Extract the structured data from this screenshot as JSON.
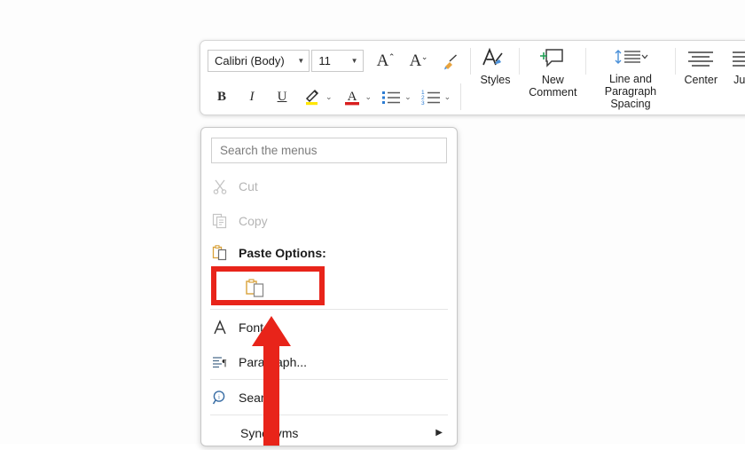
{
  "app": {
    "context": "word-mini-toolbar-and-context-menu"
  },
  "colors": {
    "annotation_red": "#e8241a",
    "highlight_yellow": "#ffe600",
    "font_color_red": "#d81f1f",
    "accent_blue": "#2b7cd3",
    "paste_gold": "#d9a23a",
    "disabled_gray": "#b5b5b5"
  },
  "toolbar": {
    "font_name": "Calibri (Body)",
    "font_size": "11",
    "font_name_caret": "▼",
    "font_size_caret": "▼",
    "increase_font_label": "A",
    "increase_font_marker": "⌃",
    "decrease_font_label": "A",
    "decrease_font_marker": "⌄",
    "format_painter_icon": "format-painter-icon",
    "bold_label": "B",
    "italic_label": "I",
    "underline_label": "U",
    "highlight_icon": "text-highlight-icon",
    "highlight_caret": "⌄",
    "font_color_label": "A",
    "font_color_caret": "⌄",
    "bullets_icon": "bullet-list-icon",
    "bullets_caret": "⌄",
    "numbering_icon": "numbered-list-icon",
    "numbering_caret": "⌄",
    "styles_label": "Styles",
    "styles_caret": "⌄",
    "new_comment_label": "New\nComment",
    "line_spacing_label": "Line and\nParagraph Spacing",
    "line_spacing_caret": "⌄",
    "center_label": "Center",
    "justify_label": "Justi"
  },
  "context_menu": {
    "search_placeholder": "Search the menus",
    "items": [
      {
        "label": "Cut",
        "icon": "scissors-icon",
        "disabled": true,
        "underline": ""
      },
      {
        "label": "Copy",
        "icon": "copy-icon",
        "disabled": true,
        "underline": "C"
      },
      {
        "label": "Paste Options:",
        "icon": "clipboard-icon",
        "disabled": false,
        "bold": true
      },
      {
        "label": "Font...",
        "icon": "font-a-icon",
        "disabled": false,
        "underline": "F"
      },
      {
        "label": "Paragraph...",
        "icon": "paragraph-icon",
        "disabled": false,
        "underline": "P"
      },
      {
        "label": "Search",
        "icon": "smart-lookup-icon",
        "disabled": false,
        "underline": "h"
      },
      {
        "label": "Synonyms",
        "icon": "",
        "disabled": false,
        "underline": "y",
        "submenu_arrow": "▶"
      }
    ],
    "paste_option_icon": "paste-keep-source-formatting-icon"
  },
  "annotations": {
    "highlight_box_target": "paste-options-button",
    "arrow_direction": "up"
  }
}
